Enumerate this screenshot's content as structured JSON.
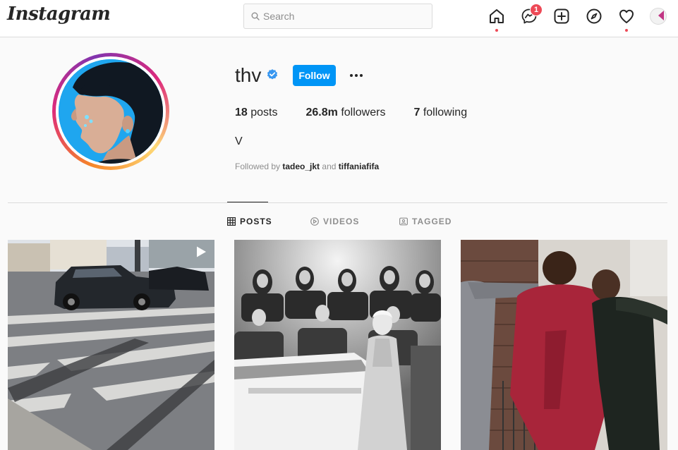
{
  "nav": {
    "logo": "Instagram",
    "search_placeholder": "Search",
    "messenger_badge": "1"
  },
  "profile": {
    "username": "thv",
    "follow_label": "Follow",
    "posts_count": "18",
    "posts_label": "posts",
    "followers_count": "26.8m",
    "followers_label": "followers",
    "following_count": "7",
    "following_label": "following",
    "full_name": "V",
    "followed_by_prefix": "Followed by",
    "followed_by_1": "tadeo_jkt",
    "followed_by_and": "and",
    "followed_by_2": "tiffaniafifa"
  },
  "tabs": [
    {
      "label": "POSTS",
      "icon": "grid-icon",
      "active": true
    },
    {
      "label": "VIDEOS",
      "icon": "play-circle-icon",
      "active": false
    },
    {
      "label": "TAGGED",
      "icon": "tag-person-icon",
      "active": false
    }
  ],
  "posts": [
    {
      "kind": "video",
      "description": "street-crosswalk"
    },
    {
      "kind": "image",
      "description": "bw-orchestra"
    },
    {
      "kind": "image",
      "description": "two-men-red-suit"
    }
  ],
  "colors": {
    "accent": "#0095f6",
    "badge": "#ed4956",
    "border": "#dbdbdb",
    "muted": "#8e8e8e",
    "text": "#262626",
    "background": "#fafafa"
  }
}
